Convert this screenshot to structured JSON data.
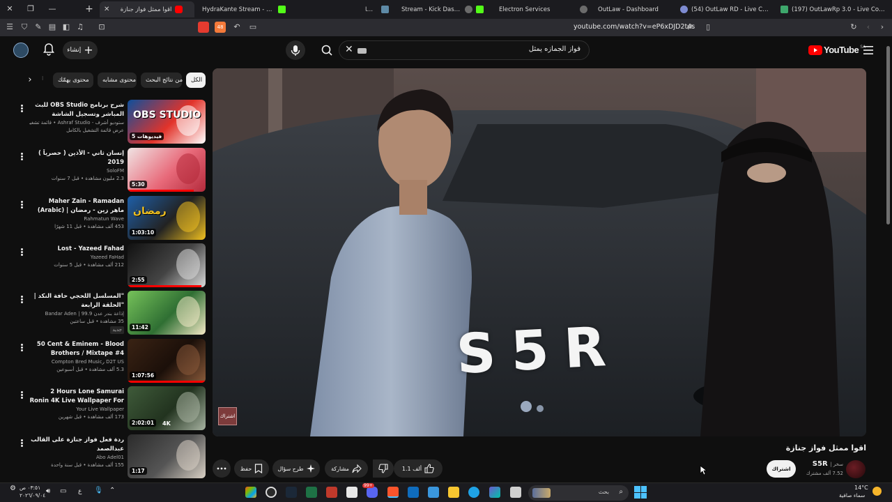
{
  "browser": {
    "tabs": [
      {
        "title": "اقوا ممثل فواز جنازة",
        "active": true
      },
      {
        "title": "HydraKante Stream - Watch Live"
      },
      {
        "title": "شاشا"
      },
      {
        "title": "Stream - Kick Dashboard"
      },
      {
        "title": "Electron Services"
      },
      {
        "title": "OutLaw - Dashboard"
      },
      {
        "title": "(54) OutLaw RD - Live Console"
      },
      {
        "title": "(197) OutLawRp 3.0 - Live Console"
      }
    ],
    "url": "youtube.com/watch?v=eP6xDJD2t4s",
    "extension_badge_count": "48"
  },
  "header": {
    "create_label": "إنشاء",
    "search_value": "فواز الجمازه يمثل",
    "logo_text": "YouTube",
    "logo_country": "SA"
  },
  "chips": [
    "الكل",
    "من نتائج البحث",
    "محتوى مشابه",
    "محتوى يهمّك"
  ],
  "recommendations": [
    {
      "title": "شرح برنامج OBS Studio للبث المباشر وتسجيل الشاشة",
      "channel": "ستوديو أشرف - Ashraf Studio • قائمة تشغيل",
      "stats": "عرض قائمة التشغيل بالكامل",
      "duration": "5 فيديوهات",
      "thumb_colors": [
        "#0d4f9c",
        "#ffffff",
        "#e2332a"
      ],
      "thumb_text": "OBS STUDIO"
    },
    {
      "title": "إنسان ثاني - الأذين ( حصرياً ) 2019",
      "channel": "SoloFM",
      "stats": "2.3 مليون مشاهدة • قبل 7 سنوات",
      "duration": "5:30",
      "thumb_colors": [
        "#f0e4e4",
        "#b42a3b",
        "#e86a7a"
      ],
      "progress": 0.85
    },
    {
      "title": "Maher Zain - Ramadan (Arabic) | ماهر زين - رمضان Official Music ...",
      "channel": "Rahmatun Wave",
      "stats": "453 ألف مشاهدة • قبل 11 شهرًا",
      "duration": "1:03:10",
      "thumb_colors": [
        "#1e5fa8",
        "#f0c020",
        "#222222"
      ],
      "thumb_text": "رمضان",
      "en": true
    },
    {
      "title": "Lost - Yazeed Fahad",
      "channel": "Yazeed FaHad",
      "stats": "212 ألف مشاهدة • قبل 5 سنوات",
      "duration": "2:55",
      "thumb_colors": [
        "#111111",
        "#d8d8d8",
        "#444444"
      ],
      "progress": 0.95,
      "en": true
    },
    {
      "title": "\"المسلسل اللحجي حافة النكد | \"الحلقة الرابعة",
      "channel": "إذاعة بندر عدن 99.9 | Bandar Aden",
      "stats": "35 مشاهدة • قبل ساعتين",
      "extra": "جديد",
      "duration": "11:42",
      "thumb_colors": [
        "#76c25a",
        "#f3e9c6",
        "#2f6f33"
      ]
    },
    {
      "title": "50 Cent & Eminem - Blood Brothers / Mixtape #4 (2026)",
      "channel": "D2T US رCompton Bred Music",
      "stats": "5.3 ألف مشاهدة • قبل أسبوعين",
      "duration": "1:07:56",
      "thumb_colors": [
        "#3a2314",
        "#8a5a3a",
        "#1b0f09"
      ],
      "progress": 1.0,
      "en": true
    },
    {
      "title": "2 Hours Lone Samurai Ronin 4K Live Wallpaper For PC ...",
      "channel": "Your Live Wallpaper",
      "stats": "173 ألف مشاهدة • قبل شهرين",
      "duration": "2:02:01",
      "badge": "4K",
      "thumb_colors": [
        "#3f5b3a",
        "#a7b3a1",
        "#22331f"
      ],
      "en": true
    },
    {
      "title": "ردة فعل فواز جنازة على القالب عبدالصمد",
      "channel": "Abo Adel01",
      "stats": "155 ألف مشاهدة • قبل سنة واحدة",
      "duration": "1:17",
      "thumb_colors": [
        "#2b2b2b",
        "#d8d0c4",
        "#555555"
      ]
    }
  ],
  "player": {
    "overlay_text": "S5R",
    "watermark_label": "اشتراك"
  },
  "video": {
    "title": "اقوا ممثل فواز جنازة",
    "channel": "S5R",
    "channel_suffix": "سخر |",
    "subscribers": "7.52 ألف مشترك",
    "subscribe_label": "اشتراك",
    "likes": "1.1 ألف",
    "share_label": "مشاركة",
    "ask_label": "طرح سؤال",
    "save_label": "حفظ"
  },
  "taskbar": {
    "time": "٠٣:٥١ ص",
    "date": "٢٠٢٦/٠٩/٠٤",
    "lang": "ع",
    "search_label": "بحث",
    "weather_temp": "14°C",
    "weather_desc": "سماء صافية",
    "browser_badge": "99+"
  },
  "colors": {
    "accent": "#ff0000",
    "background": "#0f0f0f",
    "chip": "#272727"
  }
}
